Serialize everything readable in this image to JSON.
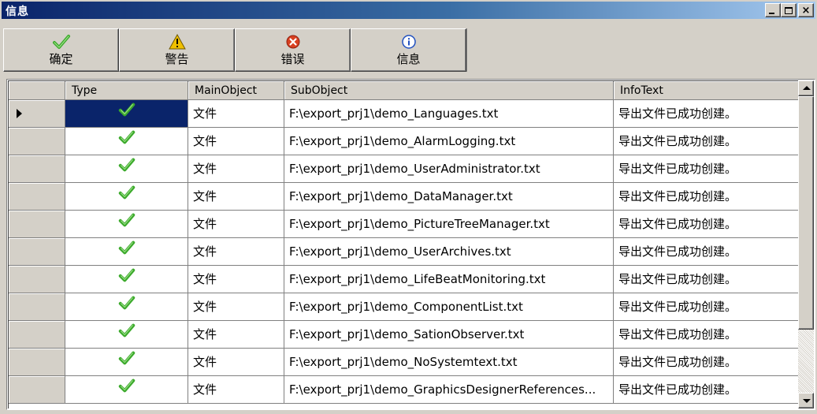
{
  "window": {
    "title": "信息"
  },
  "toolbar": {
    "buttons": [
      {
        "label": "确定",
        "icon": "check-icon",
        "color": "#3caa2c"
      },
      {
        "label": "警告",
        "icon": "warning-icon",
        "color": "#f0c000"
      },
      {
        "label": "错误",
        "icon": "error-icon",
        "color": "#d84020"
      },
      {
        "label": "信息",
        "icon": "info-icon",
        "color": "#2050c0"
      }
    ]
  },
  "grid": {
    "columns": [
      "",
      "Type",
      "MainObject",
      "SubObject",
      "InfoText"
    ],
    "selected_row": 0,
    "rows": [
      {
        "type": "check-icon",
        "main": "文件",
        "sub": "F:\\export_prj1\\demo_Languages.txt",
        "info": "导出文件已成功创建。"
      },
      {
        "type": "check-icon",
        "main": "文件",
        "sub": "F:\\export_prj1\\demo_AlarmLogging.txt",
        "info": "导出文件已成功创建。"
      },
      {
        "type": "check-icon",
        "main": "文件",
        "sub": "F:\\export_prj1\\demo_UserAdministrator.txt",
        "info": "导出文件已成功创建。"
      },
      {
        "type": "check-icon",
        "main": "文件",
        "sub": "F:\\export_prj1\\demo_DataManager.txt",
        "info": "导出文件已成功创建。"
      },
      {
        "type": "check-icon",
        "main": "文件",
        "sub": "F:\\export_prj1\\demo_PictureTreeManager.txt",
        "info": "导出文件已成功创建。"
      },
      {
        "type": "check-icon",
        "main": "文件",
        "sub": "F:\\export_prj1\\demo_UserArchives.txt",
        "info": "导出文件已成功创建。"
      },
      {
        "type": "check-icon",
        "main": "文件",
        "sub": "F:\\export_prj1\\demo_LifeBeatMonitoring.txt",
        "info": "导出文件已成功创建。"
      },
      {
        "type": "check-icon",
        "main": "文件",
        "sub": "F:\\export_prj1\\demo_ComponentList.txt",
        "info": "导出文件已成功创建。"
      },
      {
        "type": "check-icon",
        "main": "文件",
        "sub": "F:\\export_prj1\\demo_SationObserver.txt",
        "info": "导出文件已成功创建。"
      },
      {
        "type": "check-icon",
        "main": "文件",
        "sub": "F:\\export_prj1\\demo_NoSystemtext.txt",
        "info": "导出文件已成功创建。"
      },
      {
        "type": "check-icon",
        "main": "文件",
        "sub": "F:\\export_prj1\\demo_GraphicsDesignerReferences...",
        "info": "导出文件已成功创建。"
      }
    ]
  },
  "colors": {
    "titlebar_start": "#0a246a",
    "titlebar_end": "#a6caf0",
    "face": "#d4d0c8",
    "selection": "#0a246a",
    "check": "#3caa2c"
  }
}
